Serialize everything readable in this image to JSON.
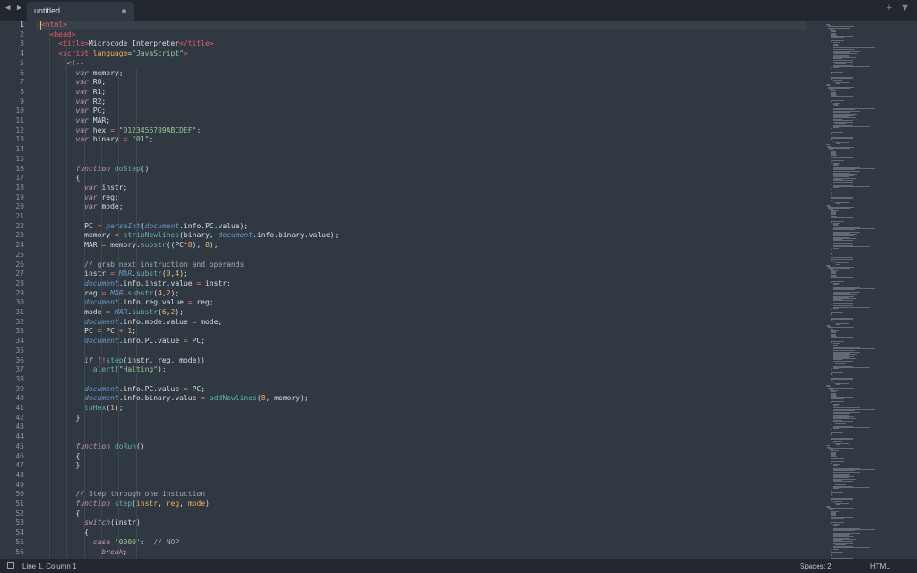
{
  "tab": {
    "title": "untitled"
  },
  "window": {
    "nav_arrows": "◀ ▶",
    "new_tab": "+",
    "tab_menu": "▼"
  },
  "status": {
    "position": "Line 1, Column 1",
    "indentation": "Spaces: 2",
    "syntax": "HTML"
  },
  "editor": {
    "current_line": 1,
    "lines": [
      [
        [
          "t",
          "<html>"
        ]
      ],
      [
        [
          "p",
          "  "
        ],
        [
          "t",
          "<head>"
        ]
      ],
      [
        [
          "p",
          "    "
        ],
        [
          "t",
          "<title>"
        ],
        [
          "p",
          "Microcode Interpreter"
        ],
        [
          "t",
          "</title>"
        ]
      ],
      [
        [
          "p",
          "    "
        ],
        [
          "t",
          "<script "
        ],
        [
          "a",
          "language"
        ],
        [
          "p",
          "="
        ],
        [
          "s",
          "\"JavaScript\""
        ],
        [
          "t",
          ">"
        ]
      ],
      [
        [
          "p",
          "      "
        ],
        [
          "c",
          "<!--"
        ]
      ],
      [
        [
          "p",
          "        "
        ],
        [
          "k",
          "var"
        ],
        [
          "p",
          " memory;"
        ]
      ],
      [
        [
          "p",
          "        "
        ],
        [
          "k",
          "var"
        ],
        [
          "p",
          " R0;"
        ]
      ],
      [
        [
          "p",
          "        "
        ],
        [
          "k",
          "var"
        ],
        [
          "p",
          " R1;"
        ]
      ],
      [
        [
          "p",
          "        "
        ],
        [
          "k",
          "var"
        ],
        [
          "p",
          " R2;"
        ]
      ],
      [
        [
          "p",
          "        "
        ],
        [
          "k",
          "var"
        ],
        [
          "p",
          " PC;"
        ]
      ],
      [
        [
          "p",
          "        "
        ],
        [
          "k",
          "var"
        ],
        [
          "p",
          " MAR;"
        ]
      ],
      [
        [
          "p",
          "        "
        ],
        [
          "k",
          "var"
        ],
        [
          "p",
          " hex "
        ],
        [
          "o",
          "="
        ],
        [
          "p",
          " "
        ],
        [
          "s",
          "\"0123456789ABCDEF\""
        ],
        [
          "p",
          ";"
        ]
      ],
      [
        [
          "p",
          "        "
        ],
        [
          "k",
          "var"
        ],
        [
          "p",
          " binary "
        ],
        [
          "o",
          "="
        ],
        [
          "p",
          " "
        ],
        [
          "s",
          "\"01\""
        ],
        [
          "p",
          ";"
        ]
      ],
      [],
      [],
      [
        [
          "p",
          "        "
        ],
        [
          "k",
          "function"
        ],
        [
          "p",
          " "
        ],
        [
          "f",
          "doStep"
        ],
        [
          "p",
          "()"
        ]
      ],
      [
        [
          "p",
          "        {"
        ]
      ],
      [
        [
          "p",
          "          "
        ],
        [
          "k",
          "var"
        ],
        [
          "p",
          " instr;"
        ]
      ],
      [
        [
          "p",
          "          "
        ],
        [
          "k",
          "var"
        ],
        [
          "p",
          " reg;"
        ]
      ],
      [
        [
          "p",
          "          "
        ],
        [
          "k",
          "var"
        ],
        [
          "p",
          " mode;"
        ]
      ],
      [],
      [
        [
          "p",
          "          PC "
        ],
        [
          "o",
          "="
        ],
        [
          "p",
          " "
        ],
        [
          "b",
          "parseInt"
        ],
        [
          "p",
          "("
        ],
        [
          "b",
          "document"
        ],
        [
          "p",
          ".info.PC.value);"
        ]
      ],
      [
        [
          "p",
          "          memory "
        ],
        [
          "o",
          "="
        ],
        [
          "p",
          " "
        ],
        [
          "f",
          "stripNewlines"
        ],
        [
          "p",
          "(binary, "
        ],
        [
          "b",
          "document"
        ],
        [
          "p",
          ".info.binary.value);"
        ]
      ],
      [
        [
          "p",
          "          MAR "
        ],
        [
          "o",
          "="
        ],
        [
          "p",
          " memory."
        ],
        [
          "f",
          "substr"
        ],
        [
          "p",
          "((PC"
        ],
        [
          "o",
          "*"
        ],
        [
          "n",
          "8"
        ],
        [
          "p",
          "), "
        ],
        [
          "n",
          "8"
        ],
        [
          "p",
          ");"
        ]
      ],
      [],
      [
        [
          "p",
          "          "
        ],
        [
          "c",
          "// grab next instruction and operands"
        ]
      ],
      [
        [
          "p",
          "          instr "
        ],
        [
          "o",
          "="
        ],
        [
          "p",
          " "
        ],
        [
          "b",
          "MAR"
        ],
        [
          "p",
          "."
        ],
        [
          "f",
          "substr"
        ],
        [
          "p",
          "("
        ],
        [
          "n",
          "0"
        ],
        [
          "p",
          ","
        ],
        [
          "n",
          "4"
        ],
        [
          "p",
          ");"
        ]
      ],
      [
        [
          "p",
          "          "
        ],
        [
          "b",
          "document"
        ],
        [
          "p",
          ".info.instr.value "
        ],
        [
          "o",
          "="
        ],
        [
          "p",
          " instr;"
        ]
      ],
      [
        [
          "p",
          "          reg "
        ],
        [
          "o",
          "="
        ],
        [
          "p",
          " "
        ],
        [
          "b",
          "MAR"
        ],
        [
          "p",
          "."
        ],
        [
          "f",
          "substr"
        ],
        [
          "p",
          "("
        ],
        [
          "n",
          "4"
        ],
        [
          "p",
          ","
        ],
        [
          "n",
          "2"
        ],
        [
          "p",
          ");"
        ]
      ],
      [
        [
          "p",
          "          "
        ],
        [
          "b",
          "document"
        ],
        [
          "p",
          ".info.reg.value "
        ],
        [
          "o",
          "="
        ],
        [
          "p",
          " reg;"
        ]
      ],
      [
        [
          "p",
          "          mode "
        ],
        [
          "o",
          "="
        ],
        [
          "p",
          " "
        ],
        [
          "b",
          "MAR"
        ],
        [
          "p",
          "."
        ],
        [
          "f",
          "substr"
        ],
        [
          "p",
          "("
        ],
        [
          "n",
          "6"
        ],
        [
          "p",
          ","
        ],
        [
          "n",
          "2"
        ],
        [
          "p",
          ");"
        ]
      ],
      [
        [
          "p",
          "          "
        ],
        [
          "b",
          "document"
        ],
        [
          "p",
          ".info.mode.value "
        ],
        [
          "o",
          "="
        ],
        [
          "p",
          " mode;"
        ]
      ],
      [
        [
          "p",
          "          PC "
        ],
        [
          "o",
          "="
        ],
        [
          "p",
          " PC "
        ],
        [
          "o",
          "+"
        ],
        [
          "p",
          " "
        ],
        [
          "n",
          "1"
        ],
        [
          "p",
          ";"
        ]
      ],
      [
        [
          "p",
          "          "
        ],
        [
          "b",
          "document"
        ],
        [
          "p",
          ".info.PC.value "
        ],
        [
          "o",
          "="
        ],
        [
          "p",
          " PC;"
        ]
      ],
      [],
      [
        [
          "p",
          "          "
        ],
        [
          "k",
          "if"
        ],
        [
          "p",
          " ("
        ],
        [
          "o",
          "!"
        ],
        [
          "f",
          "step"
        ],
        [
          "p",
          "(instr, reg, mode))"
        ]
      ],
      [
        [
          "p",
          "            "
        ],
        [
          "f",
          "alert"
        ],
        [
          "p",
          "("
        ],
        [
          "s",
          "\"Halting\""
        ],
        [
          "p",
          ");"
        ]
      ],
      [],
      [
        [
          "p",
          "          "
        ],
        [
          "b",
          "document"
        ],
        [
          "p",
          ".info.PC.value "
        ],
        [
          "o",
          "="
        ],
        [
          "p",
          " PC;"
        ]
      ],
      [
        [
          "p",
          "          "
        ],
        [
          "b",
          "document"
        ],
        [
          "p",
          ".info.binary.value "
        ],
        [
          "o",
          "="
        ],
        [
          "p",
          " "
        ],
        [
          "f",
          "addNewlines"
        ],
        [
          "p",
          "("
        ],
        [
          "n",
          "8"
        ],
        [
          "p",
          ", memory);"
        ]
      ],
      [
        [
          "p",
          "          "
        ],
        [
          "f",
          "toHex"
        ],
        [
          "p",
          "("
        ],
        [
          "n",
          "1"
        ],
        [
          "p",
          ");"
        ]
      ],
      [
        [
          "p",
          "        }"
        ]
      ],
      [],
      [],
      [
        [
          "p",
          "        "
        ],
        [
          "k",
          "function"
        ],
        [
          "p",
          " "
        ],
        [
          "f",
          "doRun"
        ],
        [
          "p",
          "()"
        ]
      ],
      [
        [
          "p",
          "        {"
        ]
      ],
      [
        [
          "p",
          "        }"
        ]
      ],
      [],
      [],
      [
        [
          "p",
          "        "
        ],
        [
          "c",
          "// Step through one instuction"
        ]
      ],
      [
        [
          "p",
          "        "
        ],
        [
          "k",
          "function"
        ],
        [
          "p",
          " "
        ],
        [
          "f",
          "step"
        ],
        [
          "p",
          "("
        ],
        [
          "a",
          "instr"
        ],
        [
          "p",
          ", "
        ],
        [
          "a",
          "reg"
        ],
        [
          "p",
          ", "
        ],
        [
          "a",
          "mode"
        ],
        [
          "p",
          ")"
        ]
      ],
      [
        [
          "p",
          "        {"
        ]
      ],
      [
        [
          "p",
          "          "
        ],
        [
          "k",
          "switch"
        ],
        [
          "p",
          "(instr)"
        ]
      ],
      [
        [
          "p",
          "          {"
        ]
      ],
      [
        [
          "p",
          "            "
        ],
        [
          "k",
          "case"
        ],
        [
          "p",
          " "
        ],
        [
          "s",
          "'0000'"
        ],
        [
          "p",
          ":  "
        ],
        [
          "c",
          "// NOP"
        ]
      ],
      [
        [
          "p",
          "              "
        ],
        [
          "k",
          "break"
        ],
        [
          "p",
          ";"
        ]
      ]
    ]
  }
}
